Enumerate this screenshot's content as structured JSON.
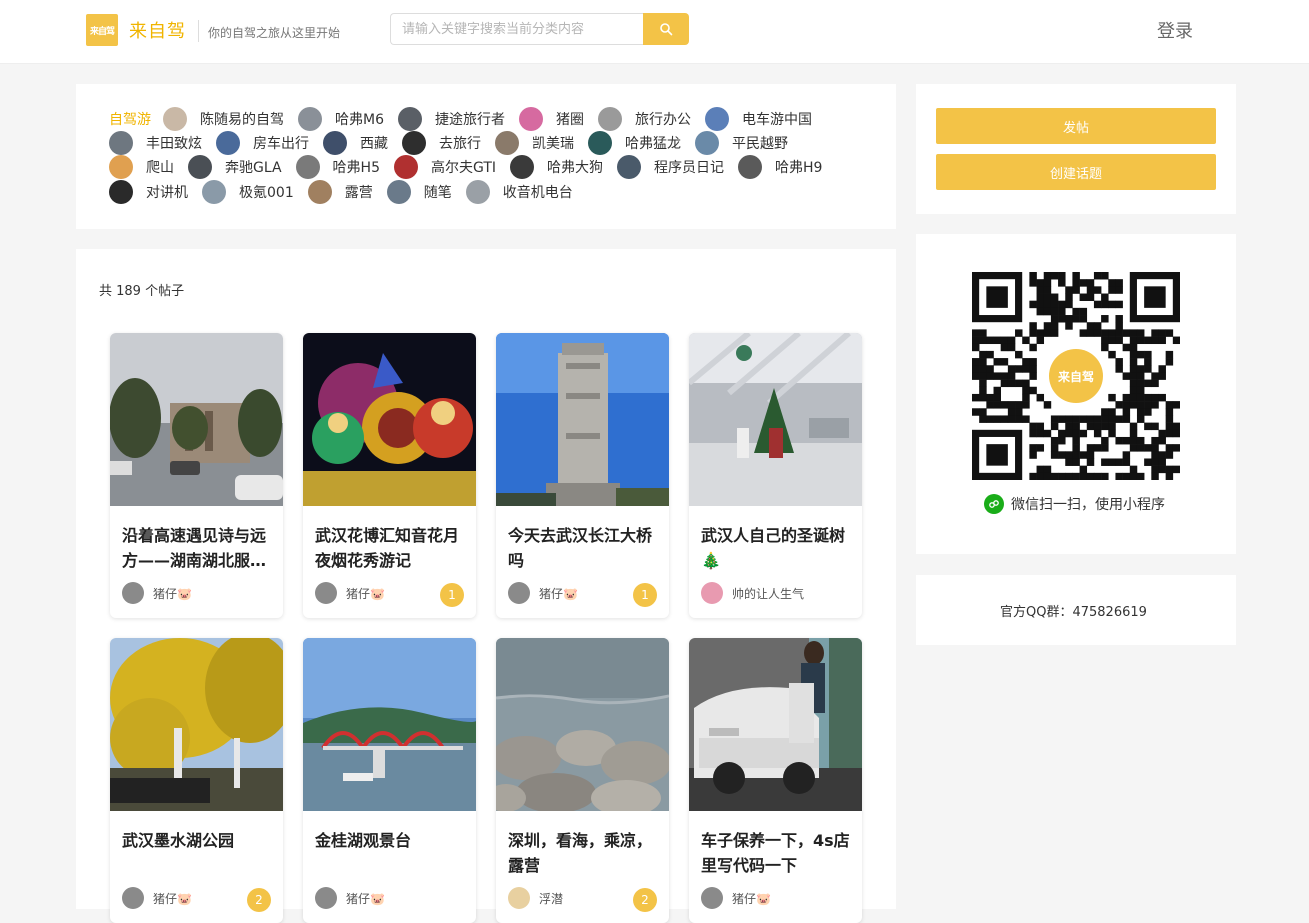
{
  "header": {
    "logo_badge": "来自驾",
    "logo_name": "来自驾",
    "slogan": "你的自驾之旅从这里开始",
    "search_placeholder": "请输入关键字搜索当前分类内容",
    "login": "登录",
    "accent_color": "#f3c347"
  },
  "topics": {
    "active": "自驾游",
    "rows": [
      [
        {
          "label": "陈随易的自驾",
          "color": "#c9b8a6"
        },
        {
          "label": "哈弗M6",
          "color": "#8a9098"
        },
        {
          "label": "捷途旅行者",
          "color": "#5a5f66"
        },
        {
          "label": "猪圈",
          "color": "#d66aa0"
        },
        {
          "label": "旅行办公",
          "color": "#9a9a9a"
        },
        {
          "label": "电车游中国",
          "color": "#5b7fb8"
        }
      ],
      [
        {
          "label": "丰田致炫",
          "color": "#6e7780"
        },
        {
          "label": "房车出行",
          "color": "#4a6a9a"
        },
        {
          "label": "西藏",
          "color": "#3f4f6a"
        },
        {
          "label": "去旅行",
          "color": "#2e2e2e"
        },
        {
          "label": "凯美瑞",
          "color": "#8a7a6a"
        },
        {
          "label": "哈弗猛龙",
          "color": "#2a5a5a"
        },
        {
          "label": "平民越野",
          "color": "#6a8aa8"
        }
      ],
      [
        {
          "label": "爬山",
          "color": "#e0a050"
        },
        {
          "label": "奔驰GLA",
          "color": "#4a4f55"
        },
        {
          "label": "哈弗H5",
          "color": "#7a7a7a"
        },
        {
          "label": "高尔夫GTI",
          "color": "#b03030"
        },
        {
          "label": "哈弗大狗",
          "color": "#3a3a3a"
        },
        {
          "label": "程序员日记",
          "color": "#4a5a6a"
        },
        {
          "label": "哈弗H9",
          "color": "#5a5a5a"
        }
      ],
      [
        {
          "label": "对讲机",
          "color": "#2a2a2a"
        },
        {
          "label": "极氪001",
          "color": "#8a9aa8"
        },
        {
          "label": "露营",
          "color": "#a08060"
        },
        {
          "label": "随笔",
          "color": "#6a7a8a"
        },
        {
          "label": "收音机电台",
          "color": "#9aa0a6"
        }
      ]
    ]
  },
  "posts": {
    "count_text": "共 189 个帖子",
    "items": [
      {
        "title": "沿着高速遇见诗与远方——湖南湖北服…",
        "author": "猪仔🐷",
        "comments": "",
        "img": "building"
      },
      {
        "title": "武汉花博汇知音花月夜烟花秀游记",
        "author": "猪仔🐷",
        "comments": "1",
        "img": "lantern"
      },
      {
        "title": "今天去武汉长江大桥吗",
        "author": "猪仔🐷",
        "comments": "1",
        "img": "tower"
      },
      {
        "title": "武汉人自己的圣诞树🎄",
        "author": "帅的让人生气",
        "comments": "",
        "img": "mall"
      },
      {
        "title": "武汉墨水湖公园",
        "author": "猪仔🐷",
        "comments": "2",
        "img": "tree"
      },
      {
        "title": "金桂湖观景台",
        "author": "猪仔🐷",
        "comments": "",
        "img": "bridge"
      },
      {
        "title": "深圳，看海，乘凉，露营",
        "author": "浮潜",
        "comments": "2",
        "img": "sea"
      },
      {
        "title": "车子保养一下，4s店里写代码一下",
        "author": "猪仔🐷",
        "comments": "",
        "img": "car"
      }
    ]
  },
  "sidebar": {
    "post_button": "发帖",
    "create_topic_button": "创建话题",
    "qr_caption": "微信扫一扫，使用小程序",
    "qq_text": "官方QQ群：475826619"
  }
}
